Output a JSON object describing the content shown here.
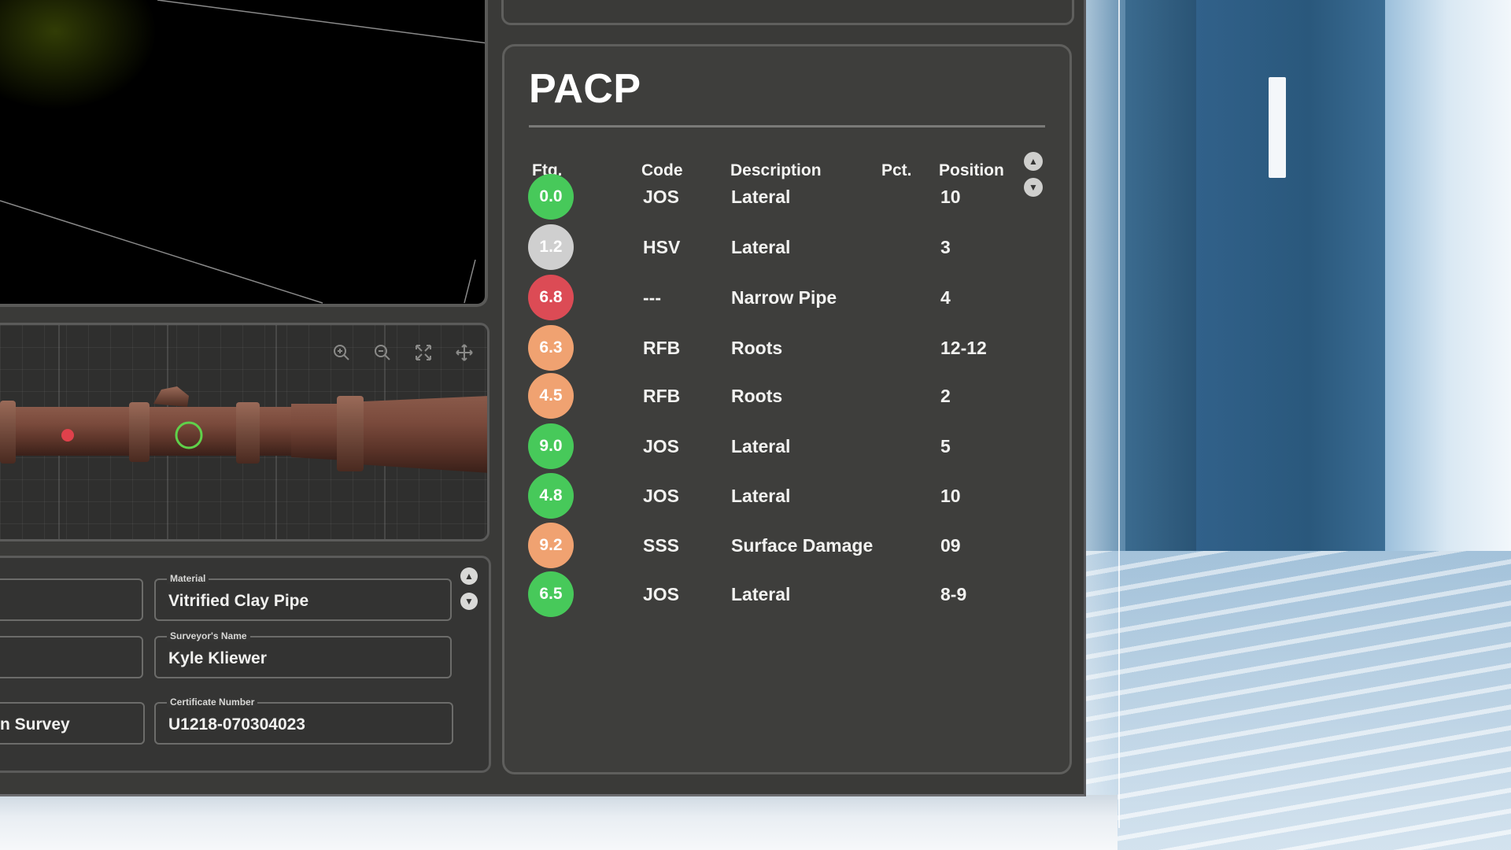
{
  "colors": {
    "green": "#47c95a",
    "gray": "#cfcfcf",
    "red": "#dc4b55",
    "orange": "#f0a271",
    "pin_red": "#e0414b",
    "ring_green": "#5fd14a"
  },
  "pipe_toolbar": {
    "zoom_in_icon": "zoom-in-icon",
    "zoom_out_icon": "zoom-out-icon",
    "fit_icon": "fit-to-screen-icon",
    "pan_icon": "pan-move-icon"
  },
  "info": {
    "material_label": "Material",
    "material_value": "Vitrified Clay Pipe",
    "surveyor_label": "Surveyor's Name",
    "surveyor_value": "Kyle Kliewer",
    "certificate_label": "Certificate Number",
    "certificate_value": "U1218-070304023",
    "left_partial_value": "n Survey"
  },
  "pacp": {
    "title": "PACP",
    "headers": {
      "ftg": "Ftg.",
      "code": "Code",
      "description": "Description",
      "pct": "Pct.",
      "position": "Position"
    },
    "rows": [
      {
        "ftg": "0.0",
        "status": "green",
        "code": "JOS",
        "description": "Lateral",
        "pct": "",
        "position": "10"
      },
      {
        "ftg": "1.2",
        "status": "gray",
        "code": "HSV",
        "description": "Lateral",
        "pct": "",
        "position": "3"
      },
      {
        "ftg": "6.8",
        "status": "red",
        "code": "---",
        "description": "Narrow Pipe",
        "pct": "",
        "position": "4"
      },
      {
        "ftg": "6.3",
        "status": "orange",
        "code": "RFB",
        "description": "Roots",
        "pct": "",
        "position": "12-12"
      },
      {
        "ftg": "4.5",
        "status": "orange",
        "code": "RFB",
        "description": "Roots",
        "pct": "",
        "position": "2"
      },
      {
        "ftg": "9.0",
        "status": "green",
        "code": "JOS",
        "description": "Lateral",
        "pct": "",
        "position": "5"
      },
      {
        "ftg": "4.8",
        "status": "green",
        "code": "JOS",
        "description": "Lateral",
        "pct": "",
        "position": "10"
      },
      {
        "ftg": "9.2",
        "status": "orange",
        "code": "SSS",
        "description": "Surface Damage",
        "pct": "",
        "position": "09"
      },
      {
        "ftg": "6.5",
        "status": "green",
        "code": "JOS",
        "description": "Lateral",
        "pct": "",
        "position": "8-9"
      }
    ]
  }
}
